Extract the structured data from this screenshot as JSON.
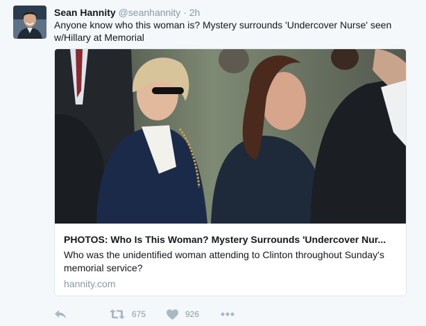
{
  "tweet": {
    "author": {
      "name": "Sean Hannity",
      "handle": "@seanhannity",
      "separator": "·",
      "time": "2h"
    },
    "text": "Anyone know who this woman is?  Mystery surrounds 'Undercover Nurse' seen w/Hillary at Memorial",
    "card": {
      "title": "PHOTOS: Who Is This Woman? Mystery Surrounds 'Undercover Nur...",
      "description": "Who was the unidentified woman attending to Clinton throughout Sunday's memorial service?",
      "domain": "hannity.com"
    },
    "actions": {
      "reply_icon": "reply-icon",
      "retweet_icon": "retweet-icon",
      "retweet_count": "675",
      "like_icon": "heart-icon",
      "like_count": "926",
      "more_icon": "more-icon"
    }
  },
  "colors": {
    "background": "#f5f8fa",
    "text": "#14171a",
    "muted": "#8899a6",
    "icon": "#aab8c2",
    "border": "#e1e8ed"
  }
}
